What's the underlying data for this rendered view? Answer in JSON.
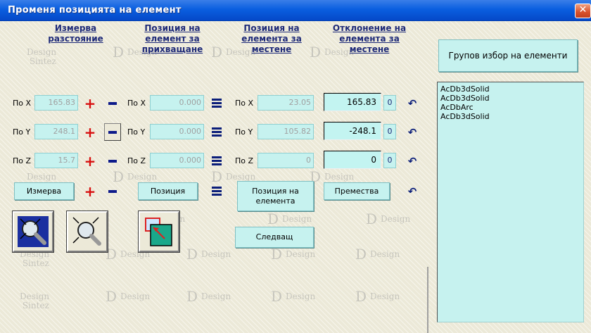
{
  "window": {
    "title": "Променя позицията на елемент",
    "close_glyph": "✕"
  },
  "columns": {
    "measure": "Измерва разстояние",
    "grip": "Позиция на елемент за прихващане",
    "element_pos": "Позиция на елемента за местене",
    "offset": "Отклонение на елемента за местене"
  },
  "axis_labels": {
    "x": "По X",
    "y": "По Y",
    "z": "По Z"
  },
  "measure_values": {
    "x": "165.83",
    "y": "248.1",
    "z": "15.7"
  },
  "grip_values": {
    "x": "0.000",
    "y": "0.000",
    "z": "0.000"
  },
  "element_values": {
    "x": "23.05",
    "y": "105.82",
    "z": "0"
  },
  "offset_values": {
    "x": "165.83",
    "y": "-248.1",
    "z": "0"
  },
  "zero_label": "0",
  "buttons": {
    "measure": "Измерва",
    "position": "Позиция",
    "element_position": "Позиция на елемента",
    "move": "Премества",
    "next": "Следващ",
    "group_select": "Групов избор на елементи"
  },
  "list_items": [
    "AcDb3dSolid",
    "AcDb3dSolid",
    "AcDbArc",
    "AcDb3dSolid"
  ],
  "watermark": {
    "design": "Design",
    "sintez": "Sintez",
    "d": "D"
  },
  "icons": {
    "plus": "+",
    "undo": "↶",
    "zoom_in": "zoom-in-icon",
    "zoom_out": "zoom-out-icon",
    "pick": "pick-point-icon"
  },
  "colors": {
    "field_bg": "#c6f2ef",
    "plus_red": "#d81010",
    "navy": "#0d1a8a",
    "header_text": "#1e2a78"
  }
}
